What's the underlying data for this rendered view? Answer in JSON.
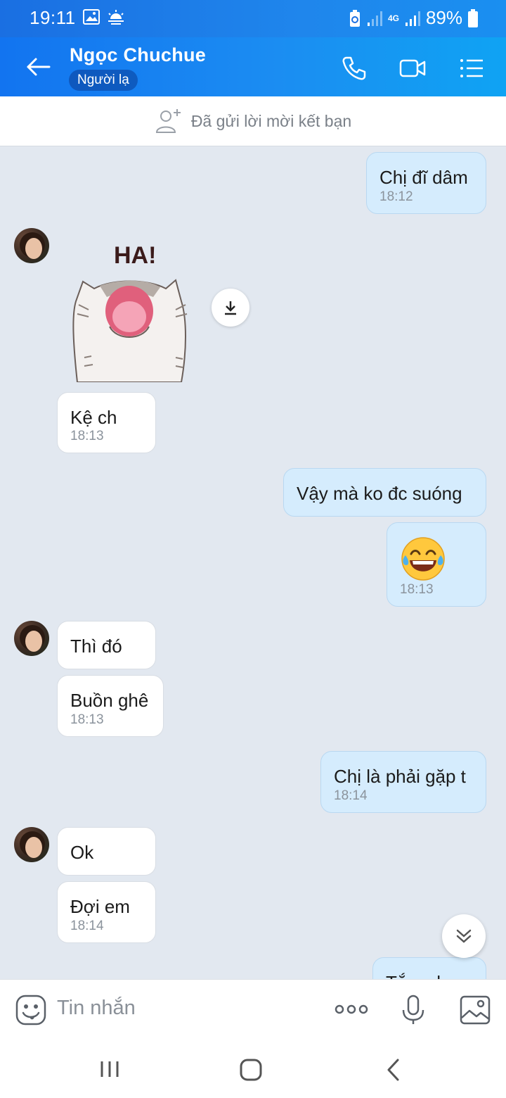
{
  "status_bar": {
    "time": "19:11",
    "battery": "89%",
    "network": "4G"
  },
  "header": {
    "contact_name": "Ngọc Chuchue",
    "badge": "Người lạ"
  },
  "friend_request": {
    "text": "Đã gửi lời mời kết bạn"
  },
  "sticker": {
    "caption": "HA!"
  },
  "messages": [
    {
      "dir": "out",
      "text": "Chị đĩ dâm",
      "time": "18:12"
    },
    {
      "dir": "in",
      "text": "Kệ ch",
      "time": "18:13"
    },
    {
      "dir": "out",
      "text": "Vậy mà ko đc suóng",
      "time": ""
    },
    {
      "dir": "out",
      "text": "😂",
      "time": "18:13"
    },
    {
      "dir": "in",
      "text": "Thì đó",
      "time": ""
    },
    {
      "dir": "in",
      "text": "Buồn ghê",
      "time": "18:13"
    },
    {
      "dir": "out",
      "text": "Chị là phải gặp t",
      "time": "18:14"
    },
    {
      "dir": "in",
      "text": "Ok",
      "time": ""
    },
    {
      "dir": "in",
      "text": "Đợi em",
      "time": "18:14"
    },
    {
      "dir": "out",
      "text": "Tắm chưa",
      "time": ""
    }
  ],
  "input": {
    "placeholder": "Tin nhắn"
  },
  "colors": {
    "header_blue": "#1b8df2",
    "out_bubble": "#d5ecfd",
    "chat_bg": "#e2e8f0"
  },
  "icons": [
    "back-arrow-icon",
    "phone-icon",
    "video-icon",
    "menu-icon",
    "add-friend-icon",
    "download-icon",
    "chevron-down-icon",
    "emoji-icon",
    "more-icon",
    "microphone-icon",
    "image-icon"
  ]
}
